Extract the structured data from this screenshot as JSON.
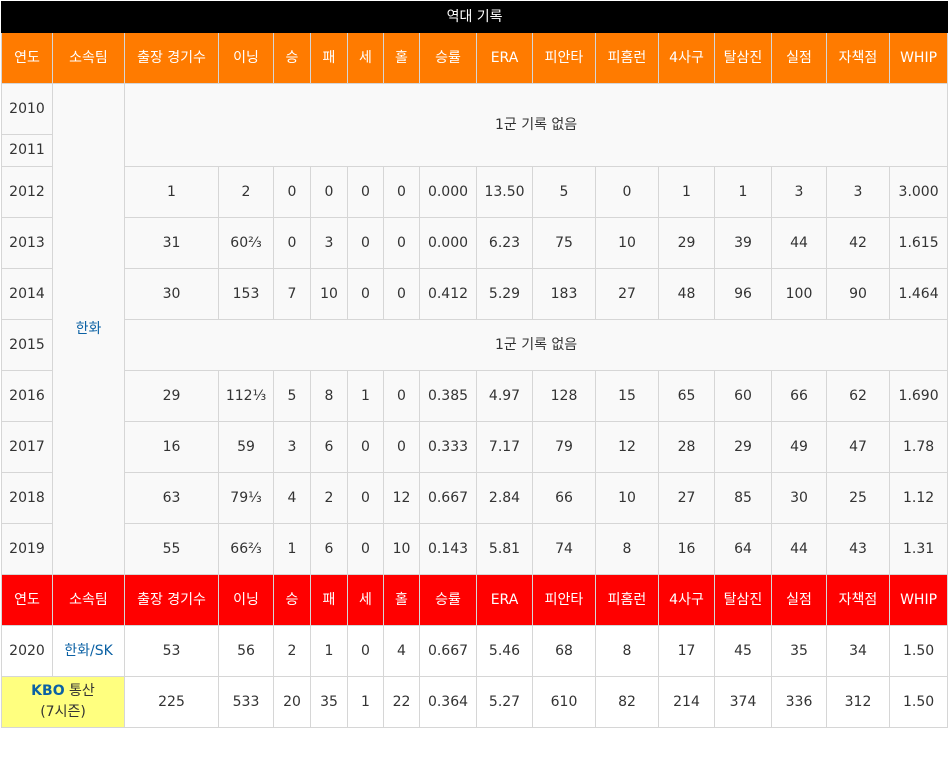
{
  "title": "역대 기록",
  "headers": [
    "연도",
    "소속팀",
    "출장 경기수",
    "이닝",
    "승",
    "패",
    "세",
    "홀",
    "승률",
    "ERA",
    "피안타",
    "피홈런",
    "4사구",
    "탈삼진",
    "실점",
    "자책점",
    "WHIP"
  ],
  "team": "한화",
  "no_record": "1군 기록 없음",
  "years": {
    "y2010": "2010",
    "y2011": "2011",
    "y2015": "2015"
  },
  "rows": [
    {
      "year": "2012",
      "g": "1",
      "ip": "2",
      "w": "0",
      "l": "0",
      "sv": "0",
      "hld": "0",
      "pct": "0.000",
      "era": "13.50",
      "h": "5",
      "hr": "0",
      "bb": "1",
      "so": "1",
      "r": "3",
      "er": "3",
      "whip": "3.000"
    },
    {
      "year": "2013",
      "g": "31",
      "ip": "60⅔",
      "w": "0",
      "l": "3",
      "sv": "0",
      "hld": "0",
      "pct": "0.000",
      "era": "6.23",
      "h": "75",
      "hr": "10",
      "bb": "29",
      "so": "39",
      "r": "44",
      "er": "42",
      "whip": "1.615"
    },
    {
      "year": "2014",
      "g": "30",
      "ip": "153",
      "w": "7",
      "l": "10",
      "sv": "0",
      "hld": "0",
      "pct": "0.412",
      "era": "5.29",
      "h": "183",
      "hr": "27",
      "bb": "48",
      "so": "96",
      "r": "100",
      "er": "90",
      "whip": "1.464"
    },
    {
      "year": "2016",
      "g": "29",
      "ip": "112⅓",
      "w": "5",
      "l": "8",
      "sv": "1",
      "hld": "0",
      "pct": "0.385",
      "era": "4.97",
      "h": "128",
      "hr": "15",
      "bb": "65",
      "so": "60",
      "r": "66",
      "er": "62",
      "whip": "1.690"
    },
    {
      "year": "2017",
      "g": "16",
      "ip": "59",
      "w": "3",
      "l": "6",
      "sv": "0",
      "hld": "0",
      "pct": "0.333",
      "era": "7.17",
      "h": "79",
      "hr": "12",
      "bb": "28",
      "so": "29",
      "r": "49",
      "er": "47",
      "whip": "1.78"
    },
    {
      "year": "2018",
      "g": "63",
      "ip": "79⅓",
      "w": "4",
      "l": "2",
      "sv": "0",
      "hld": "12",
      "pct": "0.667",
      "era": "2.84",
      "h": "66",
      "hr": "10",
      "bb": "27",
      "so": "85",
      "r": "30",
      "er": "25",
      "whip": "1.12"
    },
    {
      "year": "2019",
      "g": "55",
      "ip": "66⅔",
      "w": "1",
      "l": "6",
      "sv": "0",
      "hld": "10",
      "pct": "0.143",
      "era": "5.81",
      "h": "74",
      "hr": "8",
      "bb": "16",
      "so": "64",
      "r": "44",
      "er": "43",
      "whip": "1.31"
    }
  ],
  "row2020": {
    "year": "2020",
    "team": "한화/SK",
    "g": "53",
    "ip": "56",
    "w": "2",
    "l": "1",
    "sv": "0",
    "hld": "4",
    "pct": "0.667",
    "era": "5.46",
    "h": "68",
    "hr": "8",
    "bb": "17",
    "so": "45",
    "r": "35",
    "er": "34",
    "whip": "1.50"
  },
  "total": {
    "label_kbo": "KBO",
    "label_total": " 통산",
    "seasons": "(7시즌)",
    "g": "225",
    "ip": "533",
    "w": "20",
    "l": "35",
    "sv": "1",
    "hld": "22",
    "pct": "0.364",
    "era": "5.27",
    "h": "610",
    "hr": "82",
    "bb": "214",
    "so": "374",
    "r": "336",
    "er": "312",
    "whip": "1.50"
  },
  "colors": {
    "header_orange": "#ff7b00",
    "header_red": "#ff0000",
    "title_bg": "#000000",
    "kbo_bg": "#ffff7f",
    "link": "#0b61a4"
  }
}
